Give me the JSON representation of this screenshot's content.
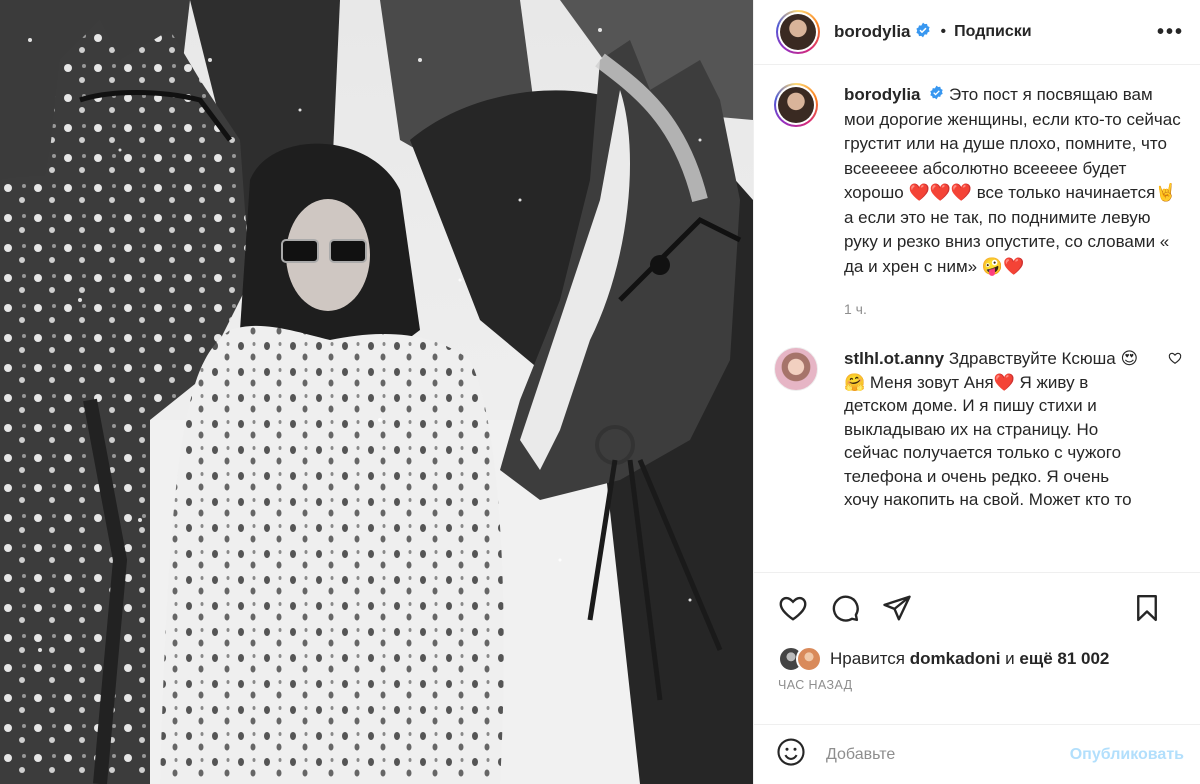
{
  "header": {
    "username": "borodylia",
    "separator": "•",
    "follow_label": "Подписки",
    "more_label": "•••"
  },
  "caption": {
    "username": "borodylia",
    "text": "Это пост я посвящаю вам мои дорогие женщины, если кто-то сейчас грустит или на душе плохо, помните, что всеееееe абсолютно всеееее будет хорошо ❤️❤️❤️ все только начинается🤘 а если это не так, по поднимите левую руку и резко вниз опустите, со словами « да и хрен с ним» 🤪❤️",
    "time": "1 ч."
  },
  "comment": {
    "username": "stlhl.ot.anny",
    "text": "Здравствуйте Ксюша 😍🤗 Меня зовут Аня❤️ Я живу в детском доме. И я пишу стихи и выкладываю их на страницу. Но сейчас получается только с чужого телефона и очень редко. Я очень хочу накопить на свой. Может кто то"
  },
  "likes": {
    "prefix": "Нравится",
    "user": "domkadoni",
    "joiner": "и",
    "count": "ещё 81 002"
  },
  "posted_ago": "ЧАС НАЗАД",
  "add_comment": {
    "placeholder": "Добавьте",
    "publish_label": "Опубликовать"
  },
  "colors": {
    "verified": "#3897f0",
    "publish_disabled": "#b2dffc",
    "muted": "#8e8e8e"
  },
  "icons": [
    "verified-badge-icon",
    "heart-icon",
    "comment-icon",
    "share-icon",
    "bookmark-icon",
    "emoji-icon"
  ]
}
